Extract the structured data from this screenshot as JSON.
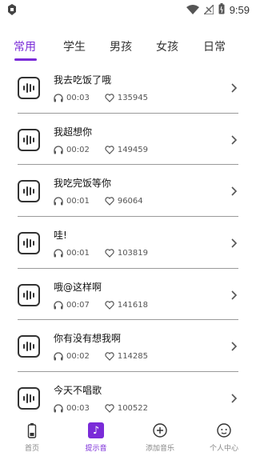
{
  "status": {
    "time": "9:59"
  },
  "tabs": [
    {
      "label": "常用",
      "active": true
    },
    {
      "label": "学生"
    },
    {
      "label": "男孩"
    },
    {
      "label": "女孩"
    },
    {
      "label": "日常"
    }
  ],
  "list": [
    {
      "title": "我去吃饭了哦",
      "duration": "00:03",
      "likes": "135945"
    },
    {
      "title": "我超想你",
      "duration": "00:02",
      "likes": "149459"
    },
    {
      "title": "我吃完饭等你",
      "duration": "00:01",
      "likes": "96064"
    },
    {
      "title": "哇!",
      "duration": "00:01",
      "likes": "103819"
    },
    {
      "title": "哦@这样啊",
      "duration": "00:07",
      "likes": "141618"
    },
    {
      "title": "你有没有想我啊",
      "duration": "00:02",
      "likes": "114285"
    },
    {
      "title": "今天不唱歌",
      "duration": "00:03",
      "likes": "100522"
    }
  ],
  "bottom_nav": [
    {
      "label": "首页",
      "icon": "battery-icon"
    },
    {
      "label": "提示音",
      "icon": "music-note-icon",
      "active": true
    },
    {
      "label": "添加音乐",
      "icon": "add-circle-icon"
    },
    {
      "label": "个人中心",
      "icon": "face-icon"
    }
  ],
  "colors": {
    "accent": "#7a2bd8"
  }
}
